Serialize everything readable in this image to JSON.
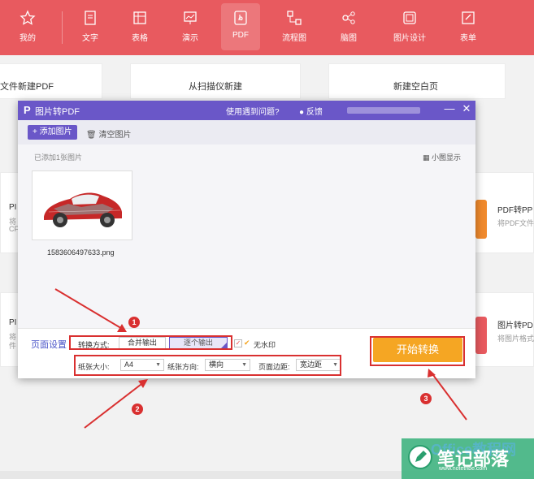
{
  "toolbar": {
    "items": [
      {
        "label": "我的",
        "icon": "star-icon"
      },
      {
        "label": "文字",
        "icon": "document-icon"
      },
      {
        "label": "表格",
        "icon": "table-icon"
      },
      {
        "label": "演示",
        "icon": "presentation-icon"
      },
      {
        "label": "PDF",
        "icon": "pdf-icon"
      },
      {
        "label": "流程图",
        "icon": "flowchart-icon"
      },
      {
        "label": "脑图",
        "icon": "mindmap-icon"
      },
      {
        "label": "图片设计",
        "icon": "image-design-icon"
      },
      {
        "label": "表单",
        "icon": "form-icon"
      }
    ],
    "active": "PDF",
    "color": "#e85a5f"
  },
  "background": {
    "new_pdf": "文件新建PDF",
    "scan_new": "从扫描仪新建",
    "new_blank": "新建空白页",
    "pdf_to_ppt": "PDF转PP",
    "pdf_to_ppt_desc": "将PDF文件转",
    "image_to_pdf_right": "图片转PD",
    "image_to_pdf_desc": "将图片格式",
    "left_pi1": "PI",
    "left_pi1_desc1": "将",
    "left_pi1_desc2": "CF",
    "left_pi2": "PI",
    "left_pi2_desc1": "将",
    "left_pi2_desc2": "件"
  },
  "dialog": {
    "logo": "P",
    "title": "图片转PDF",
    "help": "使用遇到问题?",
    "feedback": "反馈",
    "minimize": "—",
    "close": "✕",
    "add_image": "添加图片",
    "clear_images": "清空图片",
    "added_count": "已添加1张图片",
    "view_mode": "小图显示",
    "file_name": "1583606497633.png",
    "page_settings": "页面设置",
    "convert_mode_label": "转换方式:",
    "merge_output": "合并输出",
    "separate_output": "逐个输出",
    "no_watermark": "无水印",
    "paper_size_label": "纸张大小:",
    "paper_size": "A4",
    "orientation_label": "纸张方向:",
    "orientation": "横向",
    "margin_label": "页面边距:",
    "margin": "宽边距",
    "start": "开始转换",
    "accent": "#6a57c8",
    "start_color": "#f5a623"
  },
  "annotations": {
    "m1": "1",
    "m2": "2",
    "m3": "3"
  },
  "watermark": {
    "main": "笔记部落",
    "sub": "www.notetribe.com",
    "back": "Office教程网"
  }
}
